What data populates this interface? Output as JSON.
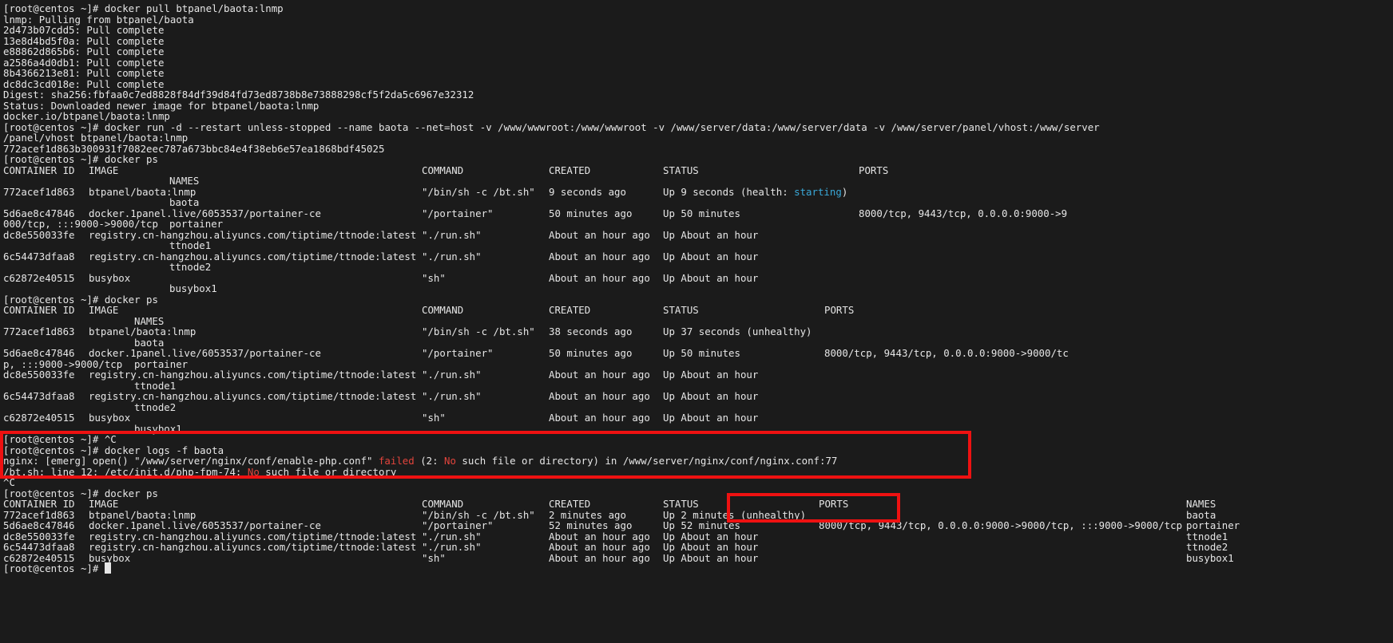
{
  "terminal": {
    "prompt": "[root@centos ~]#",
    "pull_block": {
      "cmd": "docker pull btpanel/baota:lnmp",
      "lines": [
        "lnmp: Pulling from btpanel/baota",
        "2d473b07cdd5: Pull complete",
        "13e8d4bd5f0a: Pull complete",
        "e88862d865b6: Pull complete",
        "a2586a4d0db1: Pull complete",
        "8b4366213e81: Pull complete",
        "dc8dc3cd018e: Pull complete",
        "Digest: sha256:fbfaa0c7ed8828f84df39d84fd73ed8738b8e73888298cf5f2da5c6967e32312",
        "Status: Downloaded newer image for btpanel/baota:lnmp",
        "docker.io/btpanel/baota:lnmp"
      ]
    },
    "run_block": {
      "cmd": "docker run -d --restart unless-stopped --name baota --net=host -v /www/wwwroot:/www/wwwroot -v /www/server/data:/www/server/data -v /www/server/panel/vhost:/www/server",
      "cmd_wrap": "/panel/vhost btpanel/baota:lnmp",
      "output": "772acef1d863b300931f7082eec787a673bbc84e4f38eb6e57ea1868bdf45025"
    },
    "ps1": {
      "cmd": "docker ps",
      "headers": {
        "id": "CONTAINER ID",
        "image": "IMAGE",
        "command": "COMMAND",
        "created": "CREATED",
        "status": "STATUS",
        "ports": "PORTS",
        "names": "NAMES"
      },
      "rows": [
        {
          "id": "772acef1d863",
          "image": "btpanel/baota:lnmp",
          "command": "\"/bin/sh -c /bt.sh\"",
          "created": "9 seconds ago",
          "status_prefix": "Up 9 seconds (health: ",
          "status_highlight": "starting",
          "status_suffix": ")",
          "ports": "",
          "ports_wrap": "",
          "name": "baota"
        },
        {
          "id": "5d6ae8c47846",
          "image": "docker.1panel.live/6053537/portainer-ce",
          "command": "\"/portainer\"",
          "created": "50 minutes ago",
          "status_prefix": "Up 50 minutes",
          "status_highlight": "",
          "status_suffix": "",
          "ports": "8000/tcp, 9443/tcp, 0.0.0.0:9000->9",
          "ports_wrap": "000/tcp, :::9000->9000/tcp",
          "name": "portainer"
        },
        {
          "id": "dc8e550033fe",
          "image": "registry.cn-hangzhou.aliyuncs.com/tiptime/ttnode:latest",
          "command": "\"./run.sh\"",
          "created": "About an hour ago",
          "status_prefix": "Up About an hour",
          "status_highlight": "",
          "status_suffix": "",
          "ports": "",
          "ports_wrap": "",
          "name": "ttnode1"
        },
        {
          "id": "6c54473dfaa8",
          "image": "registry.cn-hangzhou.aliyuncs.com/tiptime/ttnode:latest",
          "command": "\"./run.sh\"",
          "created": "About an hour ago",
          "status_prefix": "Up About an hour",
          "status_highlight": "",
          "status_suffix": "",
          "ports": "",
          "ports_wrap": "",
          "name": "ttnode2"
        },
        {
          "id": "c62872e40515",
          "image": "busybox",
          "command": "\"sh\"",
          "created": "About an hour ago",
          "status_prefix": "Up About an hour",
          "status_highlight": "",
          "status_suffix": "",
          "ports": "",
          "ports_wrap": "",
          "name": "busybox1"
        }
      ]
    },
    "ps2": {
      "cmd": "docker ps",
      "rows": [
        {
          "id": "772acef1d863",
          "image": "btpanel/baota:lnmp",
          "command": "\"/bin/sh -c /bt.sh\"",
          "created": "38 seconds ago",
          "status": "Up 37 seconds (unhealthy)",
          "ports": "",
          "ports_wrap": "",
          "name": "baota"
        },
        {
          "id": "5d6ae8c47846",
          "image": "docker.1panel.live/6053537/portainer-ce",
          "command": "\"/portainer\"",
          "created": "50 minutes ago",
          "status": "Up 50 minutes",
          "ports": "8000/tcp, 9443/tcp, 0.0.0.0:9000->9000/tc",
          "ports_wrap": "p, :::9000->9000/tcp",
          "name": "portainer"
        },
        {
          "id": "dc8e550033fe",
          "image": "registry.cn-hangzhou.aliyuncs.com/tiptime/ttnode:latest",
          "command": "\"./run.sh\"",
          "created": "About an hour ago",
          "status": "Up About an hour",
          "ports": "",
          "ports_wrap": "",
          "name": "ttnode1"
        },
        {
          "id": "6c54473dfaa8",
          "image": "registry.cn-hangzhou.aliyuncs.com/tiptime/ttnode:latest",
          "command": "\"./run.sh\"",
          "created": "About an hour ago",
          "status": "Up About an hour",
          "ports": "",
          "ports_wrap": "",
          "name": "ttnode2"
        },
        {
          "id": "c62872e40515",
          "image": "busybox",
          "command": "\"sh\"",
          "created": "About an hour ago",
          "status": "Up About an hour",
          "ports": "",
          "ports_wrap": "",
          "name": "busybox1"
        }
      ]
    },
    "logs_block": {
      "ctrl_c": "^C",
      "cmd": "docker logs -f baota",
      "err1_prefix": "nginx: [emerg] open() \"/www/server/nginx/conf/enable-php.conf\" ",
      "err1_failed": "failed",
      "err1_mid": " (2: ",
      "err1_no": "No",
      "err1_suffix": " such file or directory) in /www/server/nginx/conf/nginx.conf:77",
      "err2_prefix": "/bt.sh: line 12: /etc/init.d/php-fpm-74: ",
      "err2_no": "No",
      "err2_suffix": " such file or directory",
      "stray": "^C"
    },
    "ps3": {
      "cmd": "docker ps",
      "rows": [
        {
          "id": "772acef1d863",
          "image": "btpanel/baota:lnmp",
          "command": "\"/bin/sh -c /bt.sh\"",
          "created": "2 minutes ago",
          "status": "Up 2 minutes (unhealthy)",
          "ports": "",
          "name": "baota"
        },
        {
          "id": "5d6ae8c47846",
          "image": "docker.1panel.live/6053537/portainer-ce",
          "command": "\"/portainer\"",
          "created": "52 minutes ago",
          "status": "Up 52 minutes",
          "ports": "8000/tcp, 9443/tcp, 0.0.0.0:9000->9000/tcp, :::9000->9000/tcp",
          "name": "portainer"
        },
        {
          "id": "dc8e550033fe",
          "image": "registry.cn-hangzhou.aliyuncs.com/tiptime/ttnode:latest",
          "command": "\"./run.sh\"",
          "created": "About an hour ago",
          "status": "Up About an hour",
          "ports": "",
          "name": "ttnode1"
        },
        {
          "id": "6c54473dfaa8",
          "image": "registry.cn-hangzhou.aliyuncs.com/tiptime/ttnode:latest",
          "command": "\"./run.sh\"",
          "created": "About an hour ago",
          "status": "Up About an hour",
          "ports": "",
          "name": "ttnode2"
        },
        {
          "id": "c62872e40515",
          "image": "busybox",
          "command": "\"sh\"",
          "created": "About an hour ago",
          "status": "Up About an hour",
          "ports": "",
          "name": "busybox1"
        }
      ]
    }
  },
  "colors": {
    "background": "#1b1b1b",
    "text": "#e6e6e6",
    "health_starting": "#3aa9d9",
    "error_keyword": "#e2443c",
    "highlight_box": "#ee1111"
  }
}
